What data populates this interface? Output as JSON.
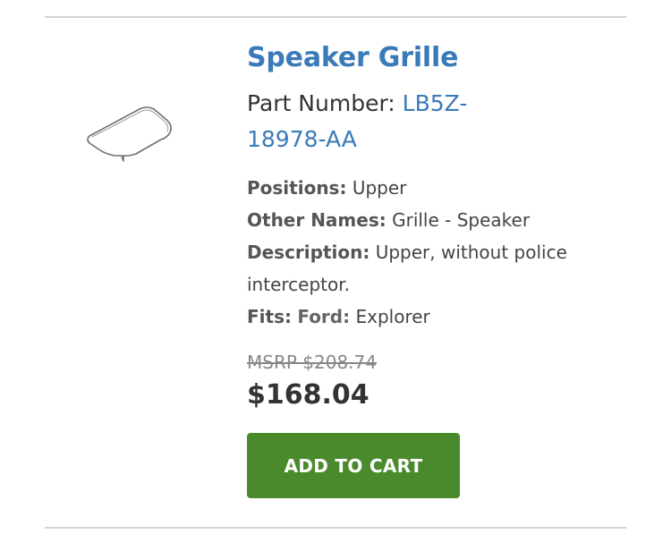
{
  "product": {
    "title": "Speaker Grille",
    "part_number_label": "Part Number:",
    "part_number": "LB5Z-18978-AA",
    "attributes": {
      "positions_label": "Positions:",
      "positions_value": "Upper",
      "other_names_label": "Other Names:",
      "other_names_value": "Grille - Speaker",
      "description_label": "Description:",
      "description_value": "Upper, without police interceptor.",
      "fits_label": "Fits:",
      "fits_make": "Ford:",
      "fits_model": "Explorer"
    },
    "msrp": "MSRP $208.74",
    "price": "$168.04",
    "add_to_cart_label": "ADD TO CART"
  },
  "icons": {
    "thumbnail": "speaker-grille-outline-icon"
  },
  "colors": {
    "link": "#3a7ab8",
    "button": "#4a8a2c",
    "divider": "#d4d4d4"
  }
}
